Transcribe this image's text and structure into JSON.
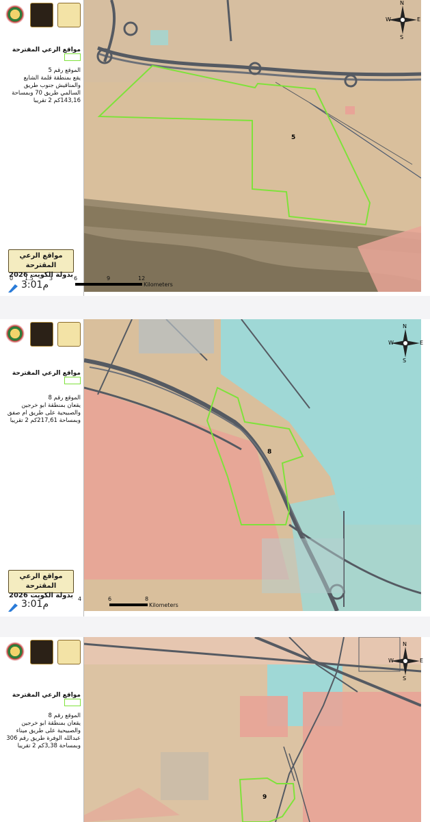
{
  "slides": [
    {
      "legend": "مواقع الرعي المقترحة",
      "desc_lines": [
        "الموقع رقم 5",
        "يقع بمنطقة قلمة الشايع",
        "والمناقيش جنوب  طريق",
        "السالمي طريق 70 وبمساحة",
        "143,16كم 2 تقريبا"
      ],
      "badge_line1": "مواقع الرعي المقترحة",
      "badge_line2": "بدولة الكويت 2026",
      "site_label": "5",
      "scale_ticks": [
        "0",
        "1.5",
        "3",
        "6",
        "9",
        "12"
      ],
      "scale_unit": "Kilometers",
      "time": "3:01",
      "time_suffix": "م"
    },
    {
      "legend": "مواقع الرعي المقترحة",
      "desc_lines": [
        "الموقع رقم 8",
        "يقعان بمنطقة ابو خرجين",
        "والصبيحية على طريق ام صفق",
        "وبمساحة 217,61كم 2 تقريبا"
      ],
      "badge_line1": "مواقع الرعي المقترحة",
      "badge_line2": "بدولة الكويت 2026",
      "site_label": "8",
      "scale_ticks": [
        "4",
        "6",
        "8"
      ],
      "scale_unit": "Kilometers",
      "time": "3:01",
      "time_suffix": "م"
    },
    {
      "legend": "مواقع الرعي المقترحة",
      "desc_lines": [
        "الموقع رقم 8",
        "يقعان بمنطقة ابو خرجين",
        "والصبيحية على طريق ميناء",
        "عبدالله الوفرة طريق رقم 306",
        "وبمساحة 3,38كم 2 تقريبا"
      ],
      "site_label": "9"
    }
  ],
  "compass": {
    "n": "N",
    "s": "S",
    "e": "E",
    "w": "W"
  },
  "colors": {
    "desert": "#d9bf9c",
    "desert_dark": "#c9ad88",
    "pink_zone": "#e8a497",
    "cyan_zone": "#9fd8d6",
    "site_outline": "#7ee23a",
    "road": "#555a62"
  }
}
